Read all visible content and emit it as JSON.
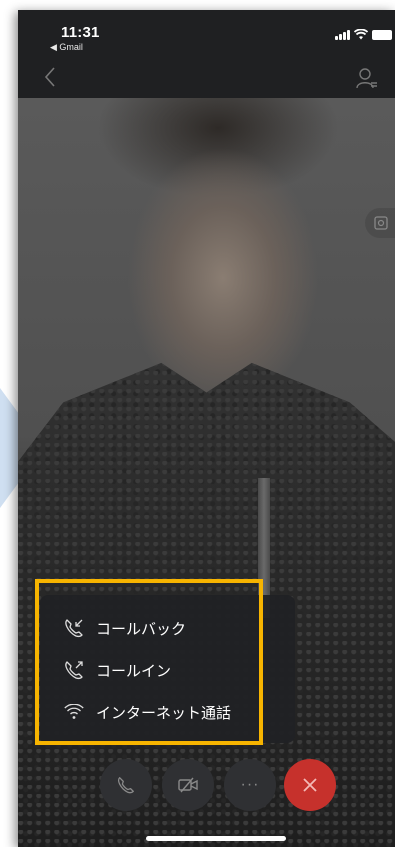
{
  "status_bar": {
    "time": "11:31",
    "back_app": "◀ Gmail"
  },
  "menu": {
    "items": [
      {
        "label": "コールバック",
        "icon": "call-back-icon"
      },
      {
        "label": "コールイン",
        "icon": "call-in-icon"
      },
      {
        "label": "インターネット通話",
        "icon": "wifi-icon"
      }
    ]
  },
  "controls": {
    "more_label": "···"
  },
  "colors": {
    "highlight": "#f7b400",
    "end_call": "#c6312c",
    "accent_arrow": "#cfdff1"
  }
}
